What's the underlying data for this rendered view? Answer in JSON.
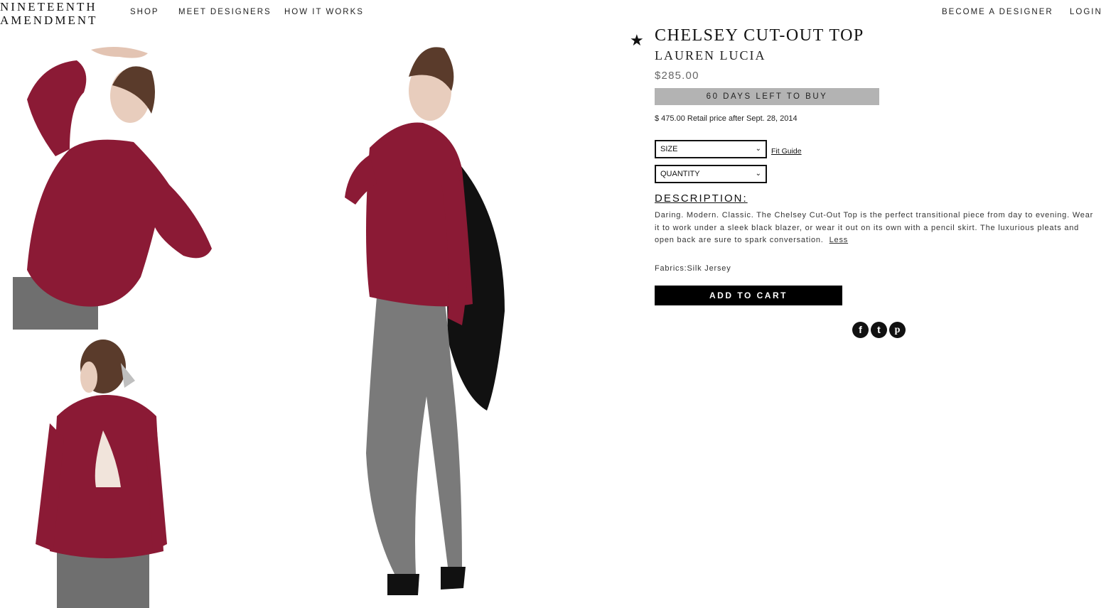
{
  "header": {
    "logo_line1": "NINETEENTH",
    "logo_line2": "AMENDMENT",
    "nav": {
      "shop": "SHOP",
      "designers": "MEET DESIGNERS",
      "how": "HOW IT WORKS",
      "become": "BECOME A DESIGNER",
      "login": "LOGIN"
    }
  },
  "product": {
    "favorite_icon": "star-icon",
    "title": "CHELSEY CUT-OUT TOP",
    "designer": "LAUREN LUCIA",
    "price": "$285.00",
    "days_left": "60 DAYS LEFT TO BUY",
    "retail_note": "$ 475.00 Retail price after Sept. 28, 2014",
    "size_select": "SIZE",
    "quantity_select": "QUANTITY",
    "fit_guide": "Fit Guide",
    "description_heading": "DESCRIPTION:",
    "description": "Daring. Modern. Classic. The Chelsey Cut-Out Top is the perfect transitional piece from day to evening. Wear it to work under a sleek black blazer, or wear it out on its own with a pencil skirt. The luxurious pleats and open back are sure to spark conversation.",
    "less_link": "Less",
    "fabrics": "Fabrics:Silk Jersey",
    "add_to_cart": "ADD TO CART"
  },
  "social": {
    "facebook_icon": "f",
    "twitter_icon": "t",
    "pinterest_icon": "p"
  },
  "colors": {
    "top": "#8b1a35",
    "pants": "#7a7a7a",
    "days_bar": "#b3b3b3",
    "button": "#000000"
  }
}
